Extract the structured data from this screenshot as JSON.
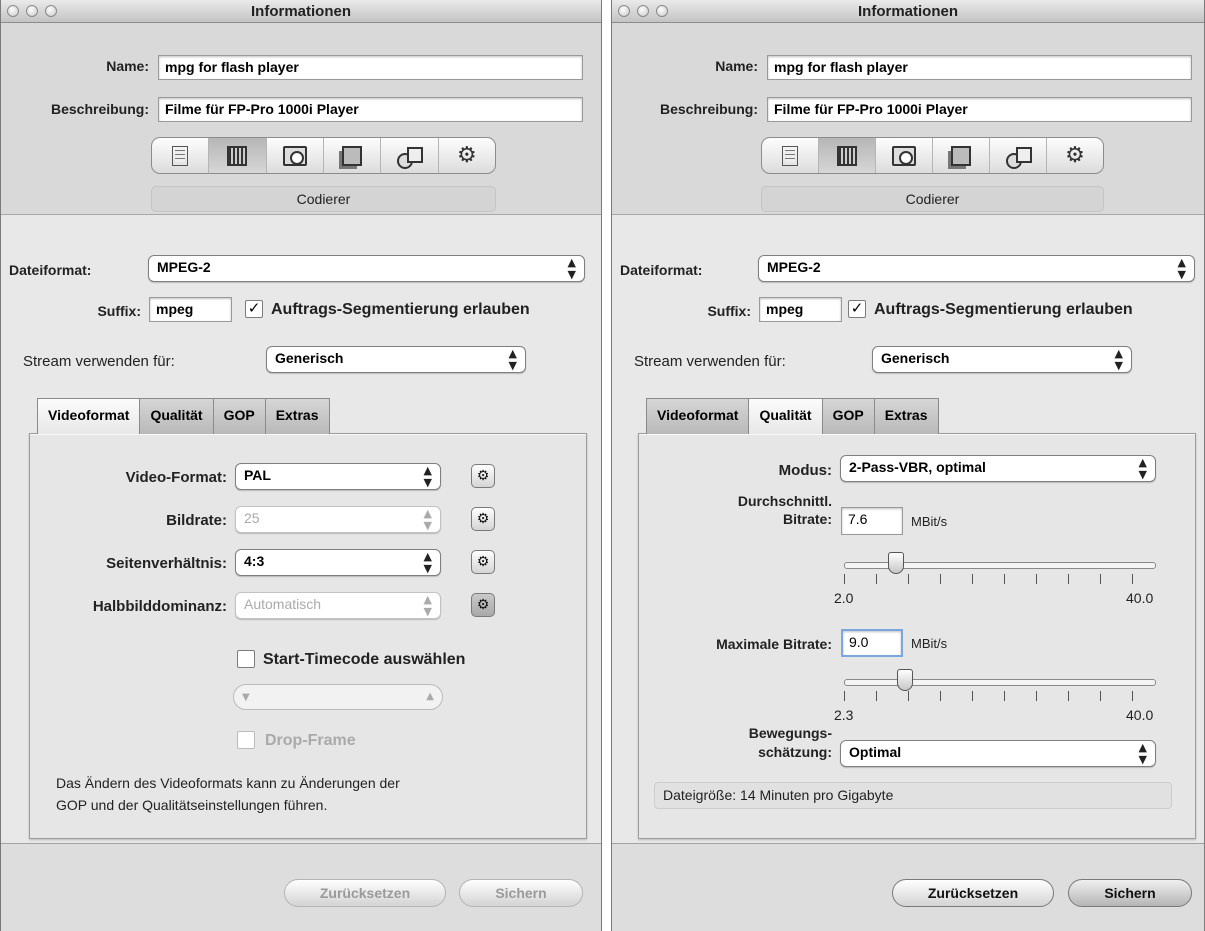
{
  "windows": [
    {
      "title": "Informationen",
      "name_label": "Name:",
      "name_value": "mpg for flash player",
      "desc_label": "Beschreibung:",
      "desc_value": "Filme für FP-Pro 1000i Player",
      "toolbar_icons": [
        "document-icon",
        "film-icon",
        "camera-icon",
        "stack-icon",
        "shapes-icon",
        "gear-icon"
      ],
      "pane_label": "Codierer",
      "dateiformat_label": "Dateiformat:",
      "dateiformat_value": "MPEG-2",
      "suffix_label": "Suffix:",
      "suffix_value": "mpeg",
      "segment_label": "Auftrags-Segmentierung erlauben",
      "segment_checked": "✓",
      "stream_label": "Stream verwenden für:",
      "stream_value": "Generisch",
      "tabs": [
        "Videoformat",
        "Qualität",
        "GOP",
        "Extras"
      ],
      "selected_tab": "Videoformat",
      "video": {
        "video_format_label": "Video-Format:",
        "video_format_value": "PAL",
        "bildrate_label": "Bildrate:",
        "bildrate_value": "25",
        "seiten_label": "Seitenverhältnis:",
        "seiten_value": "4:3",
        "halb_label": "Halbbilddominanz:",
        "halb_value": "Automatisch",
        "timecode_label": "Start-Timecode auswählen",
        "dropframe_label": "Drop-Frame",
        "note_line1": "Das Ändern des Videoformats kann zu Änderungen der",
        "note_line2": "GOP und der Qualitätseinstellungen führen."
      },
      "reset_label": "Zurücksetzen",
      "save_label": "Sichern"
    },
    {
      "title": "Informationen",
      "name_label": "Name:",
      "name_value": "mpg for flash player",
      "desc_label": "Beschreibung:",
      "desc_value": "Filme für FP-Pro 1000i Player",
      "pane_label": "Codierer",
      "dateiformat_label": "Dateiformat:",
      "dateiformat_value": "MPEG-2",
      "suffix_label": "Suffix:",
      "suffix_value": "mpeg",
      "segment_label": "Auftrags-Segmentierung erlauben",
      "segment_checked": "✓",
      "stream_label": "Stream verwenden für:",
      "stream_value": "Generisch",
      "tabs": [
        "Videoformat",
        "Qualität",
        "GOP",
        "Extras"
      ],
      "selected_tab": "Qualität",
      "quality": {
        "modus_label": "Modus:",
        "modus_value": "2-Pass-VBR, optimal",
        "avg_label_line1": "Durchschnittl.",
        "avg_label_line2": "Bitrate:",
        "avg_value": "7.6",
        "avg_unit": "MBit/s",
        "avg_min": "2.0",
        "avg_max": "40.0",
        "avg_level": 7.6,
        "max_label": "Maximale Bitrate:",
        "max_value": "9.0",
        "max_unit": "MBit/s",
        "max_min": "2.3",
        "max_max": "40.0",
        "max_level": 9.0,
        "motion_label_line1": "Bewegungs-",
        "motion_label_line2": "schätzung:",
        "motion_value": "Optimal",
        "filesize_text": "Dateigröße: 14 Minuten pro Gigabyte"
      },
      "reset_label": "Zurücksetzen",
      "save_label": "Sichern"
    }
  ]
}
